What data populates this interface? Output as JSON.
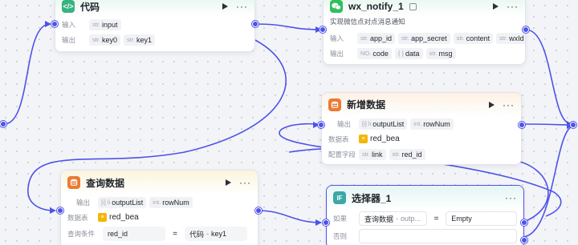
{
  "colors": {
    "accent": "#4d53e8",
    "code": "#37b37f",
    "db_orange": "#ea7b32",
    "wechat": "#2fbf5d",
    "selector": "#3ba8a8"
  },
  "code_node": {
    "title": "代码",
    "icon": "code-icon",
    "input_label": "输入",
    "output_label": "输出",
    "inputs": [
      {
        "type": "str.",
        "name": "input"
      }
    ],
    "outputs": [
      {
        "type": "str.",
        "name": "key0"
      },
      {
        "type": "str.",
        "name": "key1"
      }
    ]
  },
  "wx_node": {
    "title": "wx_notify_1",
    "icon": "wechat-icon",
    "description": "实现微信点对点消息通知",
    "input_label": "输入",
    "output_label": "输出",
    "inputs": [
      {
        "type": "str.",
        "name": "app_id"
      },
      {
        "type": "str.",
        "name": "app_secret"
      },
      {
        "type": "str.",
        "name": "content"
      },
      {
        "type": "str.",
        "name": "wxId"
      }
    ],
    "outputs": [
      {
        "type": "NO.",
        "name": "code"
      },
      {
        "type": "{ }",
        "name": "data"
      },
      {
        "type": "str.",
        "name": "msg"
      }
    ]
  },
  "add_node": {
    "title": "新增数据",
    "icon": "database-add-icon",
    "output_label": "输出",
    "table_label": "数据表",
    "fields_label": "配置字段",
    "outputs": [
      {
        "type": "[i] li",
        "name": "outputList"
      },
      {
        "type": "int.",
        "name": "rowNum"
      }
    ],
    "table": "red_bea",
    "fields": [
      {
        "type": "str.",
        "name": "link"
      },
      {
        "type": "str.",
        "name": "red_id"
      }
    ]
  },
  "query_node": {
    "title": "查询数据",
    "icon": "database-query-icon",
    "output_label": "输出",
    "table_label": "数据表",
    "condition_label": "查询条件",
    "outputs": [
      {
        "type": "[i] li",
        "name": "outputList"
      },
      {
        "type": "int.",
        "name": "rowNum"
      }
    ],
    "table": "red_bea",
    "condition": {
      "field": "red_id",
      "op": "=",
      "value_source": "代码",
      "value_sep": "-",
      "value_field": "key1"
    }
  },
  "selector_node": {
    "title": "选择器_1",
    "icon": "if-icon",
    "icon_text": "IF",
    "if_label": "如果",
    "else_label": "否则",
    "condition": {
      "left_source": "查询数据",
      "left_sep": "-",
      "left_field": "outp...",
      "op": "=",
      "right": "Empty"
    }
  }
}
